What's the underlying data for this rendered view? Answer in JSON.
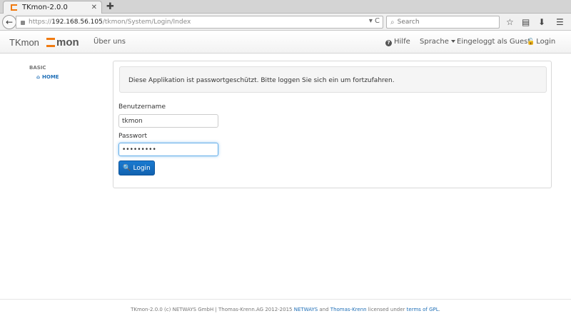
{
  "browser": {
    "tab_title": "TKmon-2.0.0",
    "tab_close": "✕",
    "new_tab": "✚",
    "url_prefix": "https://",
    "url_host": "192.168.56.105",
    "url_path": "/tkmon/System/Login/Index",
    "url_actions": "▾ C",
    "search_placeholder": "Search"
  },
  "header": {
    "brand": "TKmon",
    "logo_text": "mon",
    "about": "Über uns",
    "help": "Hilfe",
    "language": "Sprache",
    "logged_in_as": "Eingeloggt als Guest",
    "login": "Login"
  },
  "sidebar": {
    "heading": "BASIC",
    "home": "HOME"
  },
  "main": {
    "notice": "Diese Applikation ist passwortgeschützt. Bitte loggen Sie sich ein um fortzufahren.",
    "username_label": "Benutzername",
    "username_value": "tkmon",
    "password_label": "Passwort",
    "password_value": "•••••••••",
    "login_button": "Login"
  },
  "footer": {
    "text_1": "TKmon-2.0.0 (c) NETWAYS GmbH | Thomas-Krenn.AG 2012-2015 ",
    "link_netways": "NETWAYS",
    "text_2": " and ",
    "link_tk": "Thomas-Krenn",
    "text_3": " licensed under ",
    "link_gpl": "terms of GPL",
    "text_4": "."
  },
  "colors": {
    "accent": "#f07a10",
    "link": "#1f6fb7",
    "primary_button": "#1162b0"
  }
}
